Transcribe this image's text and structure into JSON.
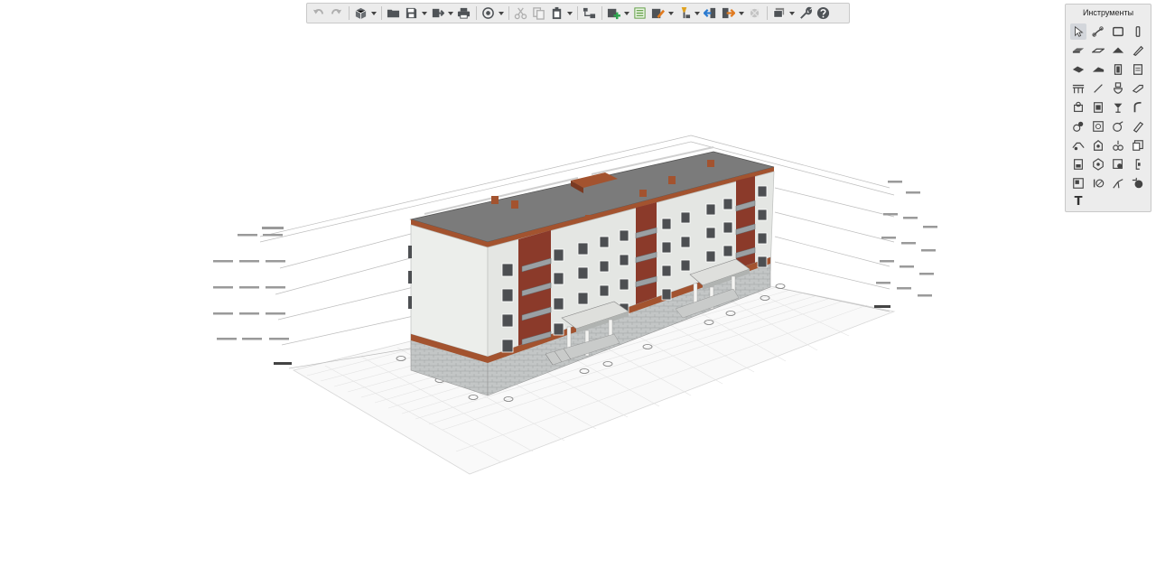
{
  "palette": {
    "title": "Инструменты",
    "text_tool_glyph": "T"
  },
  "colors": {
    "roof": "#7a7a7a",
    "wall_light": "#e9ebe8",
    "wall_shadow": "#c6c9c7",
    "accent_brick": "#8b3a2a",
    "plinth": "#b9bcbc",
    "grid": "#dcdcdc"
  }
}
